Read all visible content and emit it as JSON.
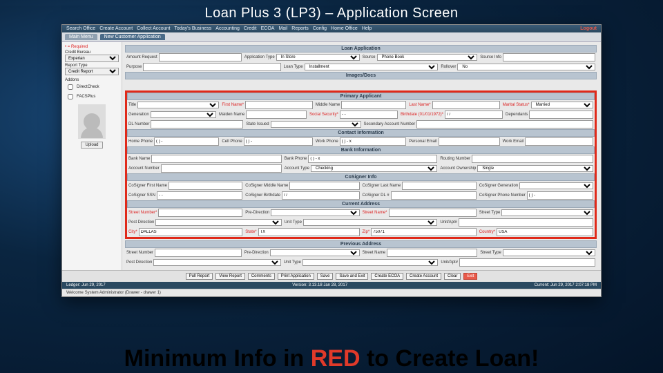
{
  "slide": {
    "title": "Loan Plus 3 (LP3) – Application Screen",
    "caption_pre": "Minimum Info in ",
    "caption_red": "RED",
    "caption_post": " to Create Loan!"
  },
  "toolbar": {
    "items": [
      "Search Office",
      "Create Account",
      "Collect Account",
      "Today's Business",
      "Accounting",
      "Credit",
      "ECOA",
      "Mail",
      "Reports",
      "Config",
      "Home Office",
      "Help"
    ],
    "logout": "Logout"
  },
  "tabs": {
    "main": "Main Menu",
    "active": "New Customer Application"
  },
  "sidebar": {
    "required": "• = Required",
    "credit_bureau_lbl": "Credit Bureau",
    "credit_bureau_val": "Experian",
    "report_type_lbl": "Report Type",
    "report_type_val": "Credit Report",
    "addons_lbl": "Addons",
    "cb1": "DirectCheck",
    "cb2": "FACSPlus",
    "upload": "Upload"
  },
  "sections": {
    "loan_app": "Loan Application",
    "images": "Images/Docs",
    "primary": "Primary Applicant",
    "contact": "Contact Information",
    "bank": "Bank Information",
    "cosigner": "CoSigner Info",
    "cur_addr": "Current Address",
    "prev_addr": "Previous Address"
  },
  "loan": {
    "amount_lbl": "Amount Request",
    "amount_val": "",
    "apptype_lbl": "Application Type",
    "apptype_val": "In Store",
    "source_lbl": "Source",
    "source_val": "Phone Book",
    "sourceinfo_lbl": "Source Info",
    "sourceinfo_val": "",
    "purpose_lbl": "Purpose",
    "purpose_val": "",
    "loantype_lbl": "Loan Type",
    "loantype_val": "Installment",
    "rollover_lbl": "Rollover",
    "rollover_val": "No"
  },
  "primary": {
    "title_lbl": "Title",
    "first_lbl": "First Name*",
    "middle_lbl": "Middle Name",
    "last_lbl": "Last Name*",
    "marital_lbl": "Marital Status*",
    "marital_val": "Married",
    "gen_lbl": "Generation",
    "maiden_lbl": "Maiden Name",
    "ssn_lbl": "Social Security*",
    "ssn_val": "- -",
    "bdate_lbl": "Birthdate (01/01/1972)*",
    "bdate_val": "/ /",
    "dep_lbl": "Dependants",
    "dl_lbl": "DL Number",
    "state_lbl": "State Issued",
    "sec_lbl": "Secondary Account Number"
  },
  "contact": {
    "home_lbl": "Home Phone",
    "home_val": "( ) -",
    "cell_lbl": "Cell Phone",
    "cell_val": "( ) -",
    "work_lbl": "Work Phone",
    "work_val": "( ) - x",
    "pemail_lbl": "Personal Email",
    "wemail_lbl": "Work Email"
  },
  "bank": {
    "name_lbl": "Bank Name",
    "phone_lbl": "Bank Phone",
    "phone_val": "( ) - x",
    "routing_lbl": "Routing Number",
    "acct_lbl": "Account Number",
    "type_lbl": "Account Type",
    "type_val": "Checking",
    "own_lbl": "Account Ownership",
    "own_val": "Single"
  },
  "cosign": {
    "first_lbl": "CoSigner First Name",
    "middle_lbl": "CoSigner Middle Name",
    "last_lbl": "CoSigner Last Name",
    "gen_lbl": "CoSigner Generation",
    "ssn_lbl": "CoSigner SSN",
    "ssn_val": "- -",
    "bdate_lbl": "CoSigner Birthdate",
    "bdate_val": "/ /",
    "dl_lbl": "CoSigner DL #",
    "phone_lbl": "CoSigner Phone Number",
    "phone_val": "( ) -"
  },
  "addr": {
    "num_lbl": "Street Number*",
    "predir_lbl": "Pre-Direction",
    "name_lbl": "Street Name*",
    "type_lbl": "Street Type",
    "postdir_lbl": "Post Direction",
    "utype_lbl": "Unit Type",
    "uapt_lbl": "Unit/Apt#",
    "city_lbl": "City*",
    "city_val": "DALLAS",
    "state_lbl": "State*",
    "state_val": "TX",
    "zip_lbl": "Zip*",
    "zip_val": "75071",
    "country_lbl": "Country*",
    "country_val": "USA"
  },
  "prev": {
    "num_lbl": "Street Number",
    "predir_lbl": "Pre-Direction",
    "name_lbl": "Street Name",
    "type_lbl": "Street Type",
    "postdir_lbl": "Post Direction",
    "utype_lbl": "Unit Type",
    "uapt_lbl": "Unit/Apt#"
  },
  "buttons": {
    "pull": "Pull Report",
    "view": "View Report",
    "comments": "Comments",
    "print": "Print Application",
    "save": "Save",
    "saveexit": "Save and Exit",
    "ecoa": "Create ECOA",
    "create": "Create Account",
    "clear": "Clear",
    "exit": "Exit"
  },
  "status": {
    "ledger": "Ledger: Jun 29, 2017",
    "version": "Version: 3.13.18 Jan 28, 2017",
    "current": "Current: Jun 29, 2017 2:07:18 PM",
    "welcome": "Welcome System Administrator (Drawer - drawer 1)"
  }
}
